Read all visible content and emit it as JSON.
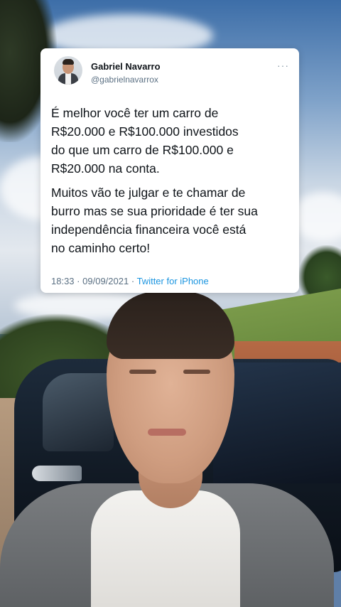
{
  "tweet": {
    "author_name": "Gabriel Navarro",
    "author_handle": "@gabrielnavarrox",
    "more_label": "···",
    "paragraph_1": "É melhor você ter um carro de\nR$20.000 e R$100.000 investidos\ndo que um carro de R$100.000 e\nR$20.000 na conta.",
    "paragraph_2": "Muitos vão te julgar e te chamar de\nburro mas se sua prioridade é ter sua\nindependência financeira você está\nno caminho certo!",
    "time": "18:33",
    "separator": "·",
    "date": "09/09/2021",
    "source": "Twitter for iPhone"
  },
  "colors": {
    "link": "#1b95e0",
    "text": "#0f1419",
    "muted": "#5b7083"
  }
}
